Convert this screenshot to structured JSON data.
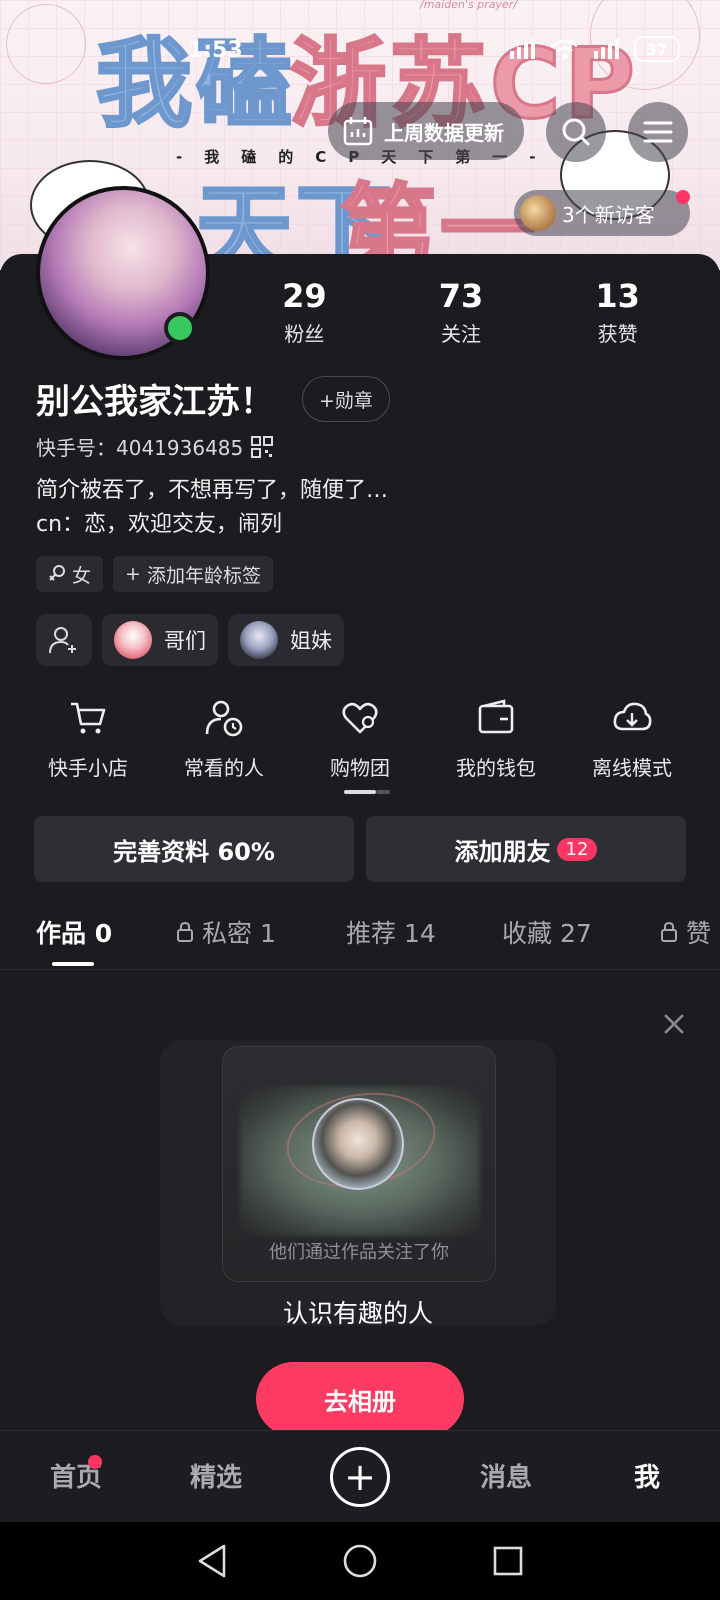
{
  "status_bar": {
    "time": "1:53",
    "battery": "37"
  },
  "banner": {
    "line1_a": "我磕",
    "line1_b": "浙苏CP",
    "line2_a": "天下",
    "line2_b": "第一",
    "subtitle": "-我磕的CP天下第一-",
    "tiny": "/maiden's prayer/"
  },
  "header": {
    "weekly_data": "上周数据更新",
    "visitors": "3个新访客"
  },
  "profile": {
    "name": "别公我家江苏！",
    "badge_btn": "+勋章",
    "uid": "快手号：4041936485",
    "bio_line1": "简介被吞了，不想再写了，随便了…",
    "bio_line2": "cn：恋，欢迎交友，闹列",
    "stats": [
      {
        "num": "29",
        "label": "粉丝"
      },
      {
        "num": "73",
        "label": "关注"
      },
      {
        "num": "13",
        "label": "获赞"
      }
    ],
    "tags": {
      "gender": "女",
      "age": "添加年龄标签"
    },
    "groups": {
      "brothers": "哥们",
      "sisters": "姐妹"
    }
  },
  "shortcuts": [
    {
      "label": "快手小店",
      "icon": "cart-icon"
    },
    {
      "label": "常看的人",
      "icon": "person-clock-icon"
    },
    {
      "label": "购物团",
      "icon": "heart-group-icon"
    },
    {
      "label": "我的钱包",
      "icon": "wallet-icon"
    },
    {
      "label": "离线模式",
      "icon": "cloud-download-icon"
    }
  ],
  "cta": {
    "complete_profile": "完善资料 60%",
    "add_friends": "添加朋友",
    "friends_count": "12"
  },
  "tabs": [
    {
      "label": "作品 0"
    },
    {
      "label": "私密 1"
    },
    {
      "label": "推荐 14"
    },
    {
      "label": "收藏 27"
    },
    {
      "label": "赞"
    }
  ],
  "recommend": {
    "subtitle": "他们通过作品关注了你",
    "title": "认识有趣的人",
    "button": "去相册"
  },
  "bottom_nav": {
    "home": "首页",
    "featured": "精选",
    "plus": "+",
    "messages": "消息",
    "me": "我"
  },
  "colors": {
    "accent": "#fe3b63",
    "online": "#37c85d",
    "background": "#1b1b20"
  }
}
